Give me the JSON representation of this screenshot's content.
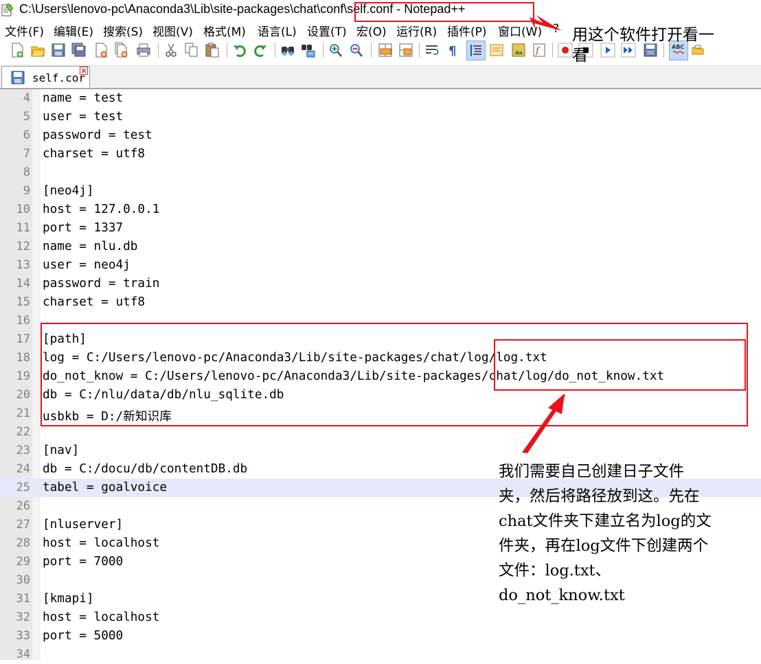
{
  "window": {
    "title": "C:\\Users\\lenovo-pc\\Anaconda3\\Lib\\site-packages\\chat\\conf\\self.conf - Notepad++"
  },
  "menu": {
    "items": [
      "文件(F)",
      "编辑(E)",
      "搜索(S)",
      "视图(V)",
      "格式(M)",
      "语言(L)",
      "设置(T)",
      "宏(O)",
      "运行(R)",
      "插件(P)",
      "窗口(W)",
      "?"
    ]
  },
  "toolbar": {
    "icons": [
      "new-file-icon",
      "open-file-icon",
      "save-icon",
      "save-all-icon",
      "close-icon",
      "close-all-icon",
      "print-icon",
      "cut-icon",
      "copy-icon",
      "paste-icon",
      "undo-icon",
      "redo-icon",
      "find-icon",
      "replace-icon",
      "zoom-in-icon",
      "zoom-out-icon",
      "sync-vertical-icon",
      "sync-horizontal-icon",
      "word-wrap-icon",
      "show-all-chars-icon",
      "indent-guide-icon",
      "user-defined-language-icon",
      "doc-map-icon",
      "function-list-icon",
      "record-macro-icon",
      "stop-macro-icon",
      "play-macro-icon",
      "run-macro-multiple-icon",
      "save-macro-icon",
      "spell-check-icon",
      "folder-as-workspace-icon"
    ]
  },
  "tab": {
    "label": "self.cor"
  },
  "editor": {
    "current_line": "25",
    "lines": [
      {
        "num": "4",
        "text": "name = test"
      },
      {
        "num": "5",
        "text": "user = test"
      },
      {
        "num": "6",
        "text": "password = test"
      },
      {
        "num": "7",
        "text": "charset = utf8"
      },
      {
        "num": "8",
        "text": ""
      },
      {
        "num": "9",
        "text": "[neo4j]"
      },
      {
        "num": "10",
        "text": "host = 127.0.0.1"
      },
      {
        "num": "11",
        "text": "port = 1337"
      },
      {
        "num": "12",
        "text": "name = nlu.db"
      },
      {
        "num": "13",
        "text": "user = neo4j"
      },
      {
        "num": "14",
        "text": "password = train"
      },
      {
        "num": "15",
        "text": "charset = utf8"
      },
      {
        "num": "16",
        "text": ""
      },
      {
        "num": "17",
        "text": "[path]"
      },
      {
        "num": "18",
        "text": "log = C:/Users/lenovo-pc/Anaconda3/Lib/site-packages/chat/log/log.txt"
      },
      {
        "num": "19",
        "text": "do_not_know = C:/Users/lenovo-pc/Anaconda3/Lib/site-packages/chat/log/do_not_know.txt"
      },
      {
        "num": "20",
        "text": "db = C:/nlu/data/db/nlu_sqlite.db"
      },
      {
        "num": "21",
        "text": "usbkb = D:/新知识库"
      },
      {
        "num": "22",
        "text": ""
      },
      {
        "num": "23",
        "text": "[nav]"
      },
      {
        "num": "24",
        "text": "db = C:/docu/db/contentDB.db"
      },
      {
        "num": "25",
        "text": "tabel = goalvoice"
      },
      {
        "num": "26",
        "text": ""
      },
      {
        "num": "27",
        "text": "[nluserver]"
      },
      {
        "num": "28",
        "text": "host = localhost"
      },
      {
        "num": "29",
        "text": "port = 7000"
      },
      {
        "num": "30",
        "text": ""
      },
      {
        "num": "31",
        "text": "[kmapi]"
      },
      {
        "num": "32",
        "text": "host = localhost"
      },
      {
        "num": "33",
        "text": "port = 5000"
      },
      {
        "num": "34",
        "text": ""
      }
    ]
  },
  "annotations": {
    "top_note": {
      "line1": "用这个软件打开看一",
      "line2": "看"
    },
    "bottom_note": {
      "lines": [
        "我们需要自己创建日子文件",
        "夹，然后将路径放到这。先在",
        "chat文件夹下建立名为log的文",
        "件夹，再在log文件下创建两个",
        "文件：log.txt、",
        "do_not_know.txt"
      ]
    },
    "color": "#e8131b"
  }
}
